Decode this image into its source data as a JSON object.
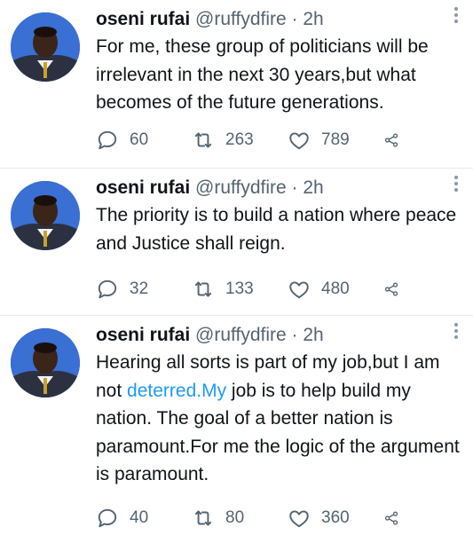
{
  "tweets": [
    {
      "name": "oseni rufai",
      "handle": "@ruffydfire",
      "dot": "·",
      "time": "2h",
      "text": "For me, these group of politicians will be irrelevant in the next 30 years,but what becomes of the future generations.",
      "replies": "60",
      "retweets": "263",
      "likes": "789"
    },
    {
      "name": "oseni rufai",
      "handle": "@ruffydfire",
      "dot": "·",
      "time": "2h",
      "text": "The priority is to build a nation where peace and Justice shall reign.",
      "replies": "32",
      "retweets": "133",
      "likes": "480"
    },
    {
      "name": "oseni rufai",
      "handle": "@ruffydfire",
      "dot": "·",
      "time": "2h",
      "text_before": "Hearing all sorts is part of my job,but I am not ",
      "text_link": "deterred.My",
      "text_after": " job is to help build my nation. The goal of a better nation is paramount.For me the logic of the argument is paramount.",
      "replies": "40",
      "retweets": "80",
      "likes": "360"
    }
  ],
  "icons": {
    "reply": "reply-icon",
    "retweet": "retweet-icon",
    "like": "heart-icon",
    "share": "share-icon",
    "more": "more-icon"
  },
  "colors": {
    "text": "#0f1419",
    "secondary": "#536471",
    "link": "#1d9bf0",
    "divider": "#e6e9ea",
    "avatar_bg": "#3a6fd4"
  }
}
